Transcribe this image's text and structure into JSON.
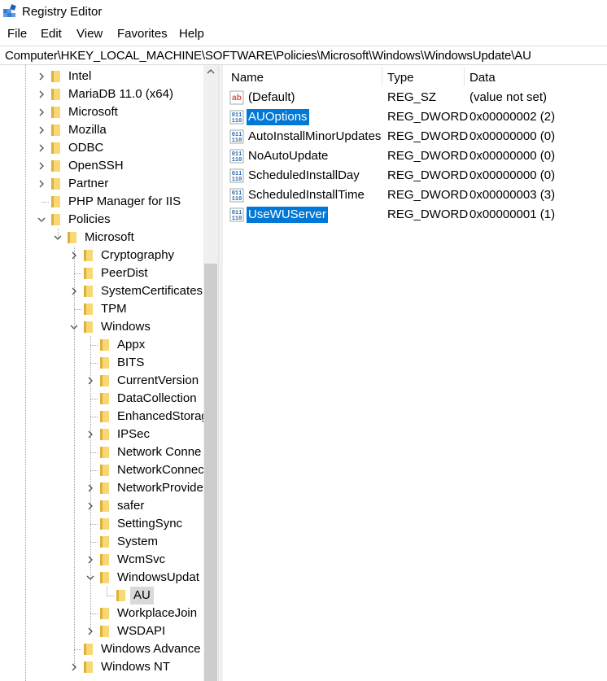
{
  "window": {
    "title": "Registry Editor"
  },
  "menu": [
    "File",
    "Edit",
    "View",
    "Favorites",
    "Help"
  ],
  "address": "Computer\\HKEY_LOCAL_MACHINE\\SOFTWARE\\Policies\\Microsoft\\Windows\\WindowsUpdate\\AU",
  "tree": [
    {
      "label": "Intel",
      "level": 0,
      "expander": "collapsed"
    },
    {
      "label": "MariaDB 11.0 (x64)",
      "level": 0,
      "expander": "collapsed"
    },
    {
      "label": "Microsoft",
      "level": 0,
      "expander": "collapsed"
    },
    {
      "label": "Mozilla",
      "level": 0,
      "expander": "collapsed"
    },
    {
      "label": "ODBC",
      "level": 0,
      "expander": "collapsed"
    },
    {
      "label": "OpenSSH",
      "level": 0,
      "expander": "collapsed"
    },
    {
      "label": "Partner",
      "level": 0,
      "expander": "collapsed"
    },
    {
      "label": "PHP Manager for IIS",
      "level": 0,
      "expander": "none"
    },
    {
      "label": "Policies",
      "level": 0,
      "expander": "expanded"
    },
    {
      "label": "Microsoft",
      "level": 1,
      "expander": "expanded"
    },
    {
      "label": "Cryptography",
      "level": 2,
      "expander": "collapsed"
    },
    {
      "label": "PeerDist",
      "level": 2,
      "expander": "none"
    },
    {
      "label": "SystemCertificates",
      "level": 2,
      "expander": "collapsed"
    },
    {
      "label": "TPM",
      "level": 2,
      "expander": "none"
    },
    {
      "label": "Windows",
      "level": 2,
      "expander": "expanded"
    },
    {
      "label": "Appx",
      "level": 3,
      "expander": "none"
    },
    {
      "label": "BITS",
      "level": 3,
      "expander": "none"
    },
    {
      "label": "CurrentVersion",
      "level": 3,
      "expander": "collapsed"
    },
    {
      "label": "DataCollection",
      "level": 3,
      "expander": "none"
    },
    {
      "label": "EnhancedStorag",
      "level": 3,
      "expander": "none"
    },
    {
      "label": "IPSec",
      "level": 3,
      "expander": "collapsed"
    },
    {
      "label": "Network Conne",
      "level": 3,
      "expander": "none"
    },
    {
      "label": "NetworkConnec",
      "level": 3,
      "expander": "none"
    },
    {
      "label": "NetworkProvide",
      "level": 3,
      "expander": "collapsed"
    },
    {
      "label": "safer",
      "level": 3,
      "expander": "collapsed"
    },
    {
      "label": "SettingSync",
      "level": 3,
      "expander": "none"
    },
    {
      "label": "System",
      "level": 3,
      "expander": "none"
    },
    {
      "label": "WcmSvc",
      "level": 3,
      "expander": "collapsed"
    },
    {
      "label": "WindowsUpdat",
      "level": 3,
      "expander": "expanded"
    },
    {
      "label": "AU",
      "level": 4,
      "expander": "none",
      "selected": true
    },
    {
      "label": "WorkplaceJoin",
      "level": 3,
      "expander": "none"
    },
    {
      "label": "WSDAPI",
      "level": 3,
      "expander": "collapsed"
    },
    {
      "label": "Windows Advance",
      "level": 2,
      "expander": "none"
    },
    {
      "label": "Windows NT",
      "level": 2,
      "expander": "collapsed"
    }
  ],
  "list": {
    "columns": {
      "name": "Name",
      "type": "Type",
      "data": "Data"
    },
    "rows": [
      {
        "name": "(Default)",
        "type": "REG_SZ",
        "data": "(value not set)",
        "icon": "string-value-icon",
        "selected": false
      },
      {
        "name": "AUOptions",
        "type": "REG_DWORD",
        "data": "0x00000002 (2)",
        "icon": "binary-value-icon",
        "selected": true
      },
      {
        "name": "AutoInstallMinorUpdates",
        "type": "REG_DWORD",
        "data": "0x00000000 (0)",
        "icon": "binary-value-icon",
        "selected": false
      },
      {
        "name": "NoAutoUpdate",
        "type": "REG_DWORD",
        "data": "0x00000000 (0)",
        "icon": "binary-value-icon",
        "selected": false
      },
      {
        "name": "ScheduledInstallDay",
        "type": "REG_DWORD",
        "data": "0x00000000 (0)",
        "icon": "binary-value-icon",
        "selected": false
      },
      {
        "name": "ScheduledInstallTime",
        "type": "REG_DWORD",
        "data": "0x00000003 (3)",
        "icon": "binary-value-icon",
        "selected": false
      },
      {
        "name": "UseWUServer",
        "type": "REG_DWORD",
        "data": "0x00000001 (1)",
        "icon": "binary-value-icon",
        "selected": true
      }
    ]
  },
  "colors": {
    "selection": "#0078d7",
    "tree_selection": "#d9d9d9",
    "folder": "#f8d775",
    "folder_dark": "#e0b03c",
    "value_icon": "#2b6cb0",
    "string_icon": "#d9534f"
  }
}
